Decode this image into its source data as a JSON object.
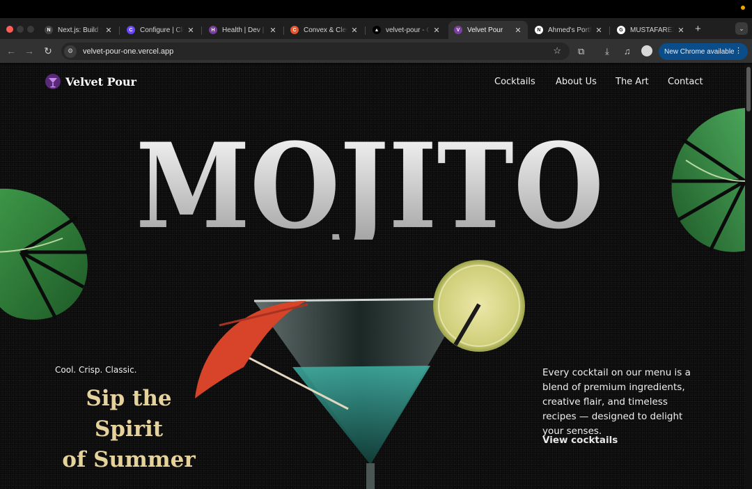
{
  "browser": {
    "tabs": [
      {
        "title": "Next.js: Build your",
        "favicon_color": "#444444",
        "favicon_glyph": "N"
      },
      {
        "title": "Configure | Clerk",
        "favicon_color": "#6c47ff",
        "favicon_glyph": "C"
      },
      {
        "title": "Health | Dev | e",
        "favicon_color": "#7a3d9a",
        "favicon_glyph": "H"
      },
      {
        "title": "Convex & Clerk",
        "favicon_color": "#e8542c",
        "favicon_glyph": "C"
      },
      {
        "title": "velvet-pour - O",
        "favicon_color": "#000000",
        "favicon_glyph": "▲"
      },
      {
        "title": "Velvet Pour",
        "favicon_color": "#7b3fa0",
        "favicon_glyph": "V"
      },
      {
        "title": "Ahmed's Portfolio",
        "favicon_color": "#ffffff",
        "favicon_glyph": "N"
      },
      {
        "title": "MUSTAFAREZA",
        "favicon_color": "#ffffff",
        "favicon_glyph": "G"
      }
    ],
    "active_tab_index": 5,
    "url": "velvet-pour-one.vercel.app",
    "update_button": "New Chrome available",
    "icons": [
      "back-arrow-icon",
      "forward-arrow-icon",
      "reload-icon",
      "site-settings-icon",
      "star-icon",
      "extensions-icon",
      "download-icon",
      "media-icon",
      "profile-avatar",
      "menu-dots-icon"
    ]
  },
  "site": {
    "brand": "Velvet Pour",
    "nav": [
      "Cocktails",
      "About Us",
      "The Art",
      "Contact"
    ],
    "hero_title": "MOJITO",
    "tagline": "Cool. Crisp. Classic.",
    "headline_line1": "Sip the Spirit",
    "headline_line2": "of Summer",
    "description": "Every cocktail on our menu is a blend of premium ingredients, creative flair, and timeless recipes — designed to delight your senses.",
    "cta": "View cocktails",
    "colors": {
      "background": "#0a0a0a",
      "headline": "#e6d39b",
      "leaf": "#2f7a3a",
      "umbrella": "#d8442a",
      "lime": "#d9d98c"
    }
  }
}
